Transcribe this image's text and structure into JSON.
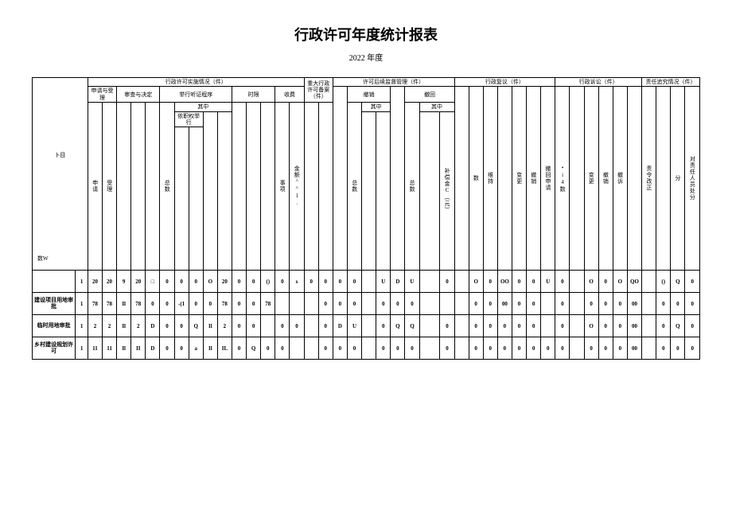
{
  "title": "行政许可年度统计报表",
  "subtitle": "2022 年度",
  "headers": {
    "item": "卜目",
    "count_w": "数W",
    "group1": "行政许可实施情况（件）",
    "group2": "重大行政许可备案（件）",
    "group3": "许可后续监督管理（件）",
    "group4": "行政复议（件）",
    "group5": "行政诉讼（件）",
    "group6": "责任追究情况（件）",
    "sub_apply": "申请与受理",
    "sub_review": "审查与决定",
    "sub_hearing": "举行听证程序",
    "sub_time": "时限",
    "sub_fee": "收费",
    "sub_revoke": "撤销",
    "sub_withdraw": "撤回",
    "of_which": "其中",
    "ex_officio": "依职权举行",
    "c_apply": "申请",
    "c_accept": "受理",
    "c_total": "总数",
    "c_matter": "事项",
    "c_amount": "金额^^1.",
    "c_comp": "补偿金C（元）",
    "c_num": "数",
    "c_maintain": "维持",
    "c_change": "变更",
    "c_revoke2": "撤销",
    "c_withdraw_app": "撤回申请",
    "c_snum": "•i4数",
    "c_change2": "变更",
    "c_revoke3": "撤销",
    "c_appeal": "撤诉",
    "c_order": "责令改正",
    "c_disp": "分",
    "c_person": "对责任人员处分"
  },
  "rows": [
    {
      "label": "",
      "idx": "1",
      "cells": [
        "20",
        "20",
        "9",
        "20",
        "□",
        "0",
        "0",
        "0",
        "O",
        "20",
        "0",
        "0",
        "()",
        "0",
        "s",
        "0",
        "0",
        "0",
        "0",
        "",
        "U",
        "D",
        "U",
        "",
        "0",
        "",
        "O",
        "0",
        "OO",
        "0",
        "0",
        "U",
        "0",
        "",
        "O",
        "0",
        "O",
        "QO",
        "",
        "()",
        "Q",
        "0"
      ]
    },
    {
      "label": "建设项目用地审批",
      "idx": "1",
      "cells": [
        "78",
        "78",
        "Il",
        "78",
        "0",
        "0",
        "-(1",
        "0",
        "0",
        "78",
        "0",
        "0",
        "78",
        "",
        "",
        "",
        "0",
        "0",
        "0",
        "",
        "0",
        "0",
        "0",
        "",
        "",
        "",
        "0",
        "0",
        "00",
        "0",
        "0",
        "",
        "0",
        "",
        "0",
        "0",
        "0",
        "00",
        "",
        "0",
        "0",
        "0"
      ]
    },
    {
      "label": "临时用地审批",
      "idx": "1",
      "cells": [
        "2",
        "2",
        "Il",
        "2",
        "D",
        "0",
        "0",
        "Q",
        "Il",
        "2",
        "0",
        "0",
        "",
        "0",
        "0",
        "",
        "0",
        "D",
        "U",
        "",
        "0",
        "Q",
        "Q",
        "",
        "0",
        "",
        "0",
        "0",
        "0",
        "0",
        "0",
        "",
        "0",
        "",
        "O",
        "0",
        "0",
        "00",
        "",
        "0",
        "Q",
        "0"
      ]
    },
    {
      "label": "乡村建设规划许可",
      "idx": "1",
      "cells": [
        "11",
        "11",
        "Il",
        "II",
        "D",
        "0",
        "0",
        "a",
        "Il",
        "IL",
        "0",
        "Q",
        "0",
        "0",
        "",
        "",
        "0",
        "0",
        "0",
        "",
        "0",
        "0",
        "0",
        "",
        "0",
        "",
        "0",
        "0",
        "0",
        "0",
        "0",
        "0",
        "0",
        "",
        "0",
        "0",
        "0",
        "00",
        "",
        "0",
        "0",
        "0"
      ]
    }
  ]
}
